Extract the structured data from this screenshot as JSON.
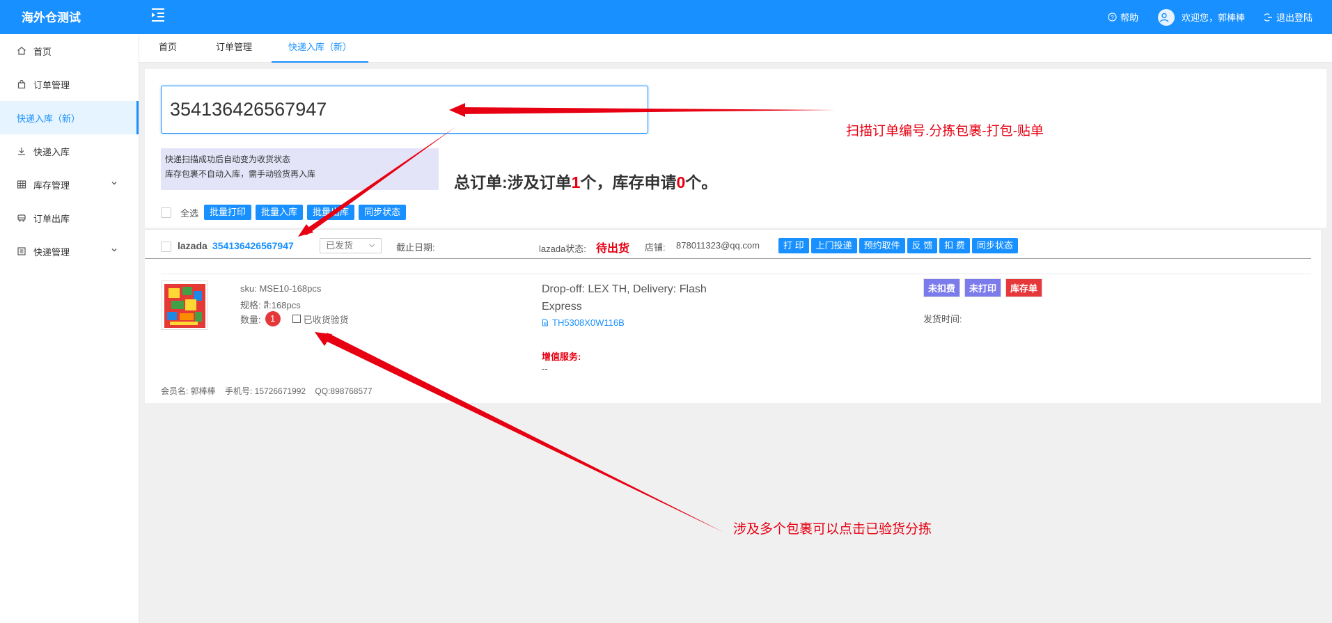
{
  "header": {
    "brand": "海外仓测试",
    "help": "帮助",
    "welcome": "欢迎您，郭棒棒",
    "logout": "退出登陆"
  },
  "sidebar": {
    "items": [
      {
        "label": "首页",
        "icon": "home-icon"
      },
      {
        "label": "订单管理",
        "icon": "shopping-bag-icon"
      },
      {
        "label": "快递入库（新）",
        "icon": "none"
      },
      {
        "label": "快递入库",
        "icon": "download-icon"
      },
      {
        "label": "库存管理",
        "icon": "table-icon"
      },
      {
        "label": "订单出库",
        "icon": "truck-icon"
      },
      {
        "label": "快递管理",
        "icon": "list-icon"
      }
    ]
  },
  "tabs": [
    {
      "label": "首页"
    },
    {
      "label": "订单管理"
    },
    {
      "label": "快递入库（新）"
    }
  ],
  "scan": {
    "value": "354136426567947"
  },
  "tips": {
    "line1": "快递扫描成功后自动变为收货状态",
    "line2": "库存包裹不自动入库，需手动验货再入库"
  },
  "summary": {
    "prefix": "总订单:涉及订单",
    "orders": "1",
    "mid": "个，库存申请",
    "stock": "0",
    "suffix": "个。"
  },
  "batch": {
    "select_all": "全选",
    "buttons": [
      "批量打印",
      "批量入库",
      "批量出库",
      "同步状态"
    ]
  },
  "order": {
    "platform": "lazada",
    "order_no": "354136426567947",
    "status_select": "已发货",
    "deadline_label": "截止日期:",
    "lazada_status_label": "lazada状态:",
    "lazada_status": "待出货",
    "shop_label": "店铺:",
    "shop": "878011323@qq.com",
    "actions": [
      "打 印",
      "上门投递",
      "预约取件",
      "反 馈",
      "扣 费",
      "同步状态"
    ],
    "sku": "sku: MSE10-168pcs",
    "spec": "规格: สี:168pcs",
    "qty_label": "数量:",
    "qty": "1",
    "received_label": "已收货验货",
    "delivery": "Drop-off: LEX TH, Delivery: Flash Express",
    "tracking": "TH5308X0W116B",
    "vas_label": "增值服务:",
    "vas_value": "--",
    "tags": [
      "未扣费",
      "未打印",
      "库存单"
    ],
    "ship_time_label": "发货时间:",
    "member": "会员名: 郭棒棒    手机号: 15726671992    QQ:898768577"
  },
  "annotations": {
    "scan_note": "扫描订单编号.分拣包裹-打包-贴单",
    "multi_note": "涉及多个包裹可以点击已验货分拣"
  },
  "colors": {
    "primary": "#1890ff",
    "alert_red": "#e60012",
    "tag_purple": "#7b7bec"
  }
}
